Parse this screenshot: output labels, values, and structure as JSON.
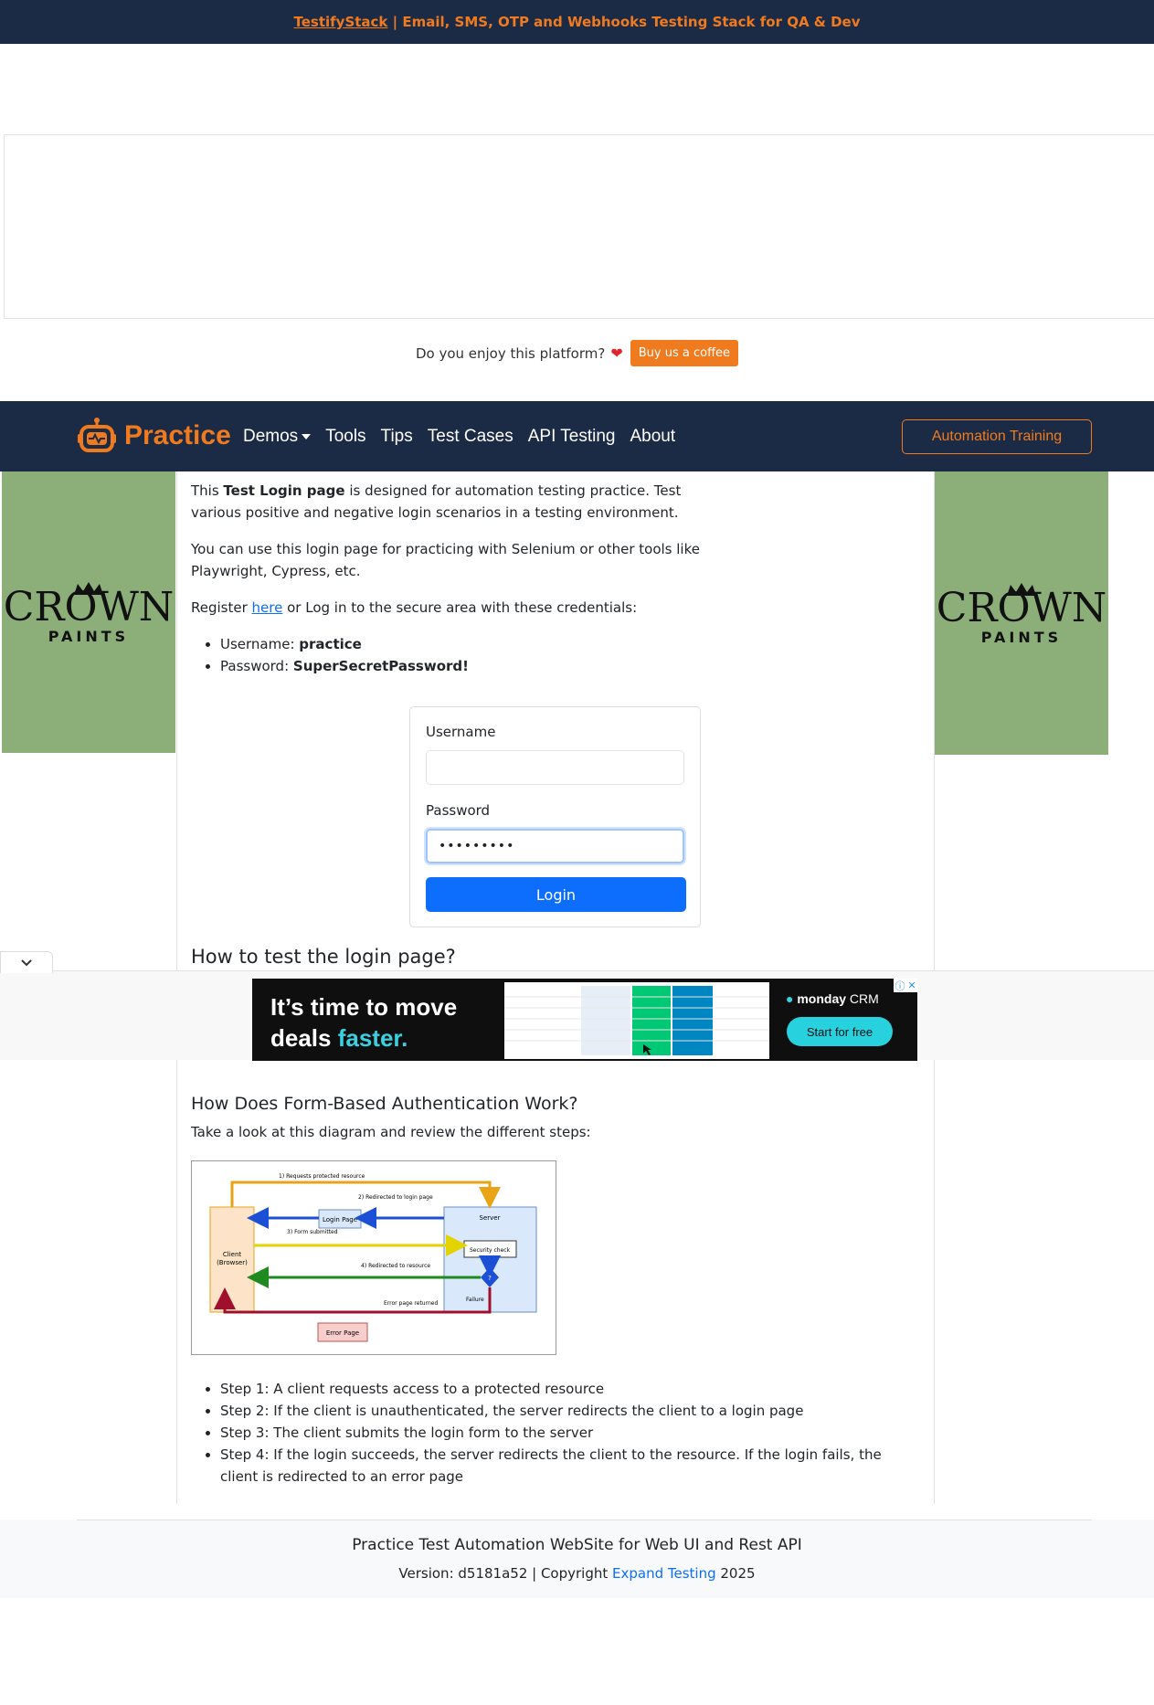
{
  "topbar": {
    "brand_link": "TestifyStack",
    "tagline": " | Email, SMS, OTP and Webhooks Testing Stack for QA & Dev"
  },
  "coffee": {
    "question": "Do you enjoy this platform?",
    "button_label": "Buy us a coffee"
  },
  "navbar": {
    "brand": "Practice",
    "links": [
      "Demos",
      "Tools",
      "Tips",
      "Test Cases",
      "API Testing",
      "About"
    ],
    "cta": "Automation Training"
  },
  "side_ads": {
    "brand": "CROWN",
    "sub": "PAINTS"
  },
  "intro": {
    "p1_pre": "This ",
    "p1_bold": "Test Login page",
    "p1_post": " is designed for automation testing practice. Test various positive and negative login scenarios in a testing environment.",
    "p2": "You can use this login page for practicing with Selenium or other tools like Playwright, Cypress, etc.",
    "p3_pre": "Register ",
    "p3_link": "here",
    "p3_post": " or Log in to the secure area with these credentials:",
    "username_label": "Username: ",
    "username_value": "practice",
    "password_label": "Password: ",
    "password_value": "SuperSecretPassword!"
  },
  "login_form": {
    "username_label": "Username",
    "username_value": "",
    "password_label": "Password",
    "password_value": "•••••••••",
    "submit_label": "Login"
  },
  "howto_heading": "How to test the login page?",
  "sticky_ad": {
    "headline_1": "It’s time to move",
    "headline_2a": "deals ",
    "headline_2b": "faster.",
    "logo": "monday",
    "logo_suffix": " CRM",
    "cta": "Start for free"
  },
  "form_auth": {
    "heading": "How Does Form-Based Authentication Work?",
    "lead": "Take a look at this diagram and review the different steps:",
    "diagram": {
      "step1": "1) Requests protected resource",
      "step2": "2) Redirected to login page",
      "step3": "3) Form submitted",
      "step4": "4) Redirected to resource",
      "client": "Client",
      "client2": "(Browser)",
      "login_page": "Login Page",
      "server": "Server",
      "security": "Security check",
      "error_page": "Error Page",
      "error_returned": "Error page returned",
      "failure": "Failure",
      "decision": "?"
    },
    "steps": [
      "Step 1: A client requests access to a protected resource",
      "Step 2: If the client is unauthenticated, the server redirects the client to a login page",
      "Step 3: The client submits the login form to the server",
      "Step 4: If the login succeeds, the server redirects the client to the resource. If the login fails, the client is redirected to an error page"
    ]
  },
  "footer": {
    "title": "Practice Test Automation WebSite for Web UI and Rest API",
    "version_pre": "Version: d5181a52 | Copyright ",
    "version_link": "Expand Testing",
    "version_post": " 2025"
  },
  "colors": {
    "navy": "#1c2b45",
    "orange": "#f07a1e",
    "primary": "#0d6efd",
    "ad_green": "#8caf7a"
  }
}
